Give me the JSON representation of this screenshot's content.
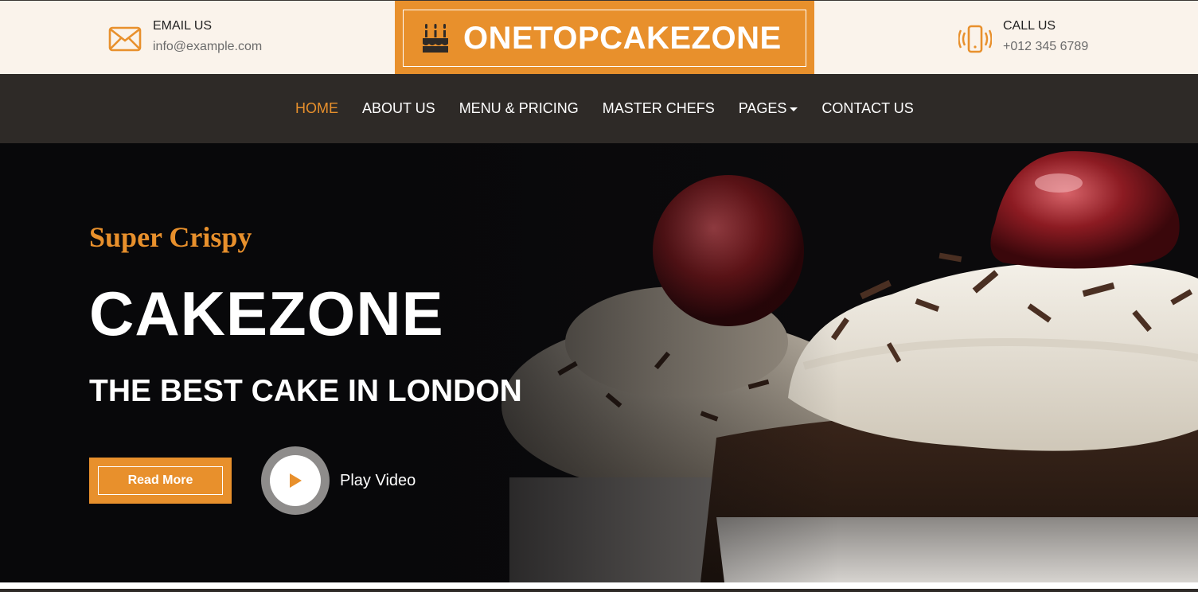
{
  "colors": {
    "accent": "#e8902c",
    "topbar_bg": "#faf3eb",
    "nav_bg": "#2e2a27",
    "hero_bg": "#0b0a0c"
  },
  "contact": {
    "email": {
      "icon": "envelope-icon",
      "title": "EMAIL US",
      "value": "info@example.com"
    },
    "call": {
      "icon": "phone-vibrate-icon",
      "title": "CALL US",
      "value": "+012 345 6789"
    }
  },
  "brand": {
    "icon": "birthday-cake-icon",
    "name": "ONETOPCAKEZONE"
  },
  "nav": {
    "items": [
      {
        "label": "HOME",
        "active": true
      },
      {
        "label": "ABOUT US"
      },
      {
        "label": "MENU & PRICING"
      },
      {
        "label": "MASTER CHEFS"
      },
      {
        "label": "PAGES",
        "dropdown": true
      },
      {
        "label": "CONTACT US"
      }
    ]
  },
  "hero": {
    "kicker": "Super Crispy",
    "headline": "CAKEZONE",
    "subline": "THE BEST CAKE IN LONDON",
    "read_more_label": "Read More",
    "play_icon": "play-icon",
    "play_label": "Play Video"
  }
}
